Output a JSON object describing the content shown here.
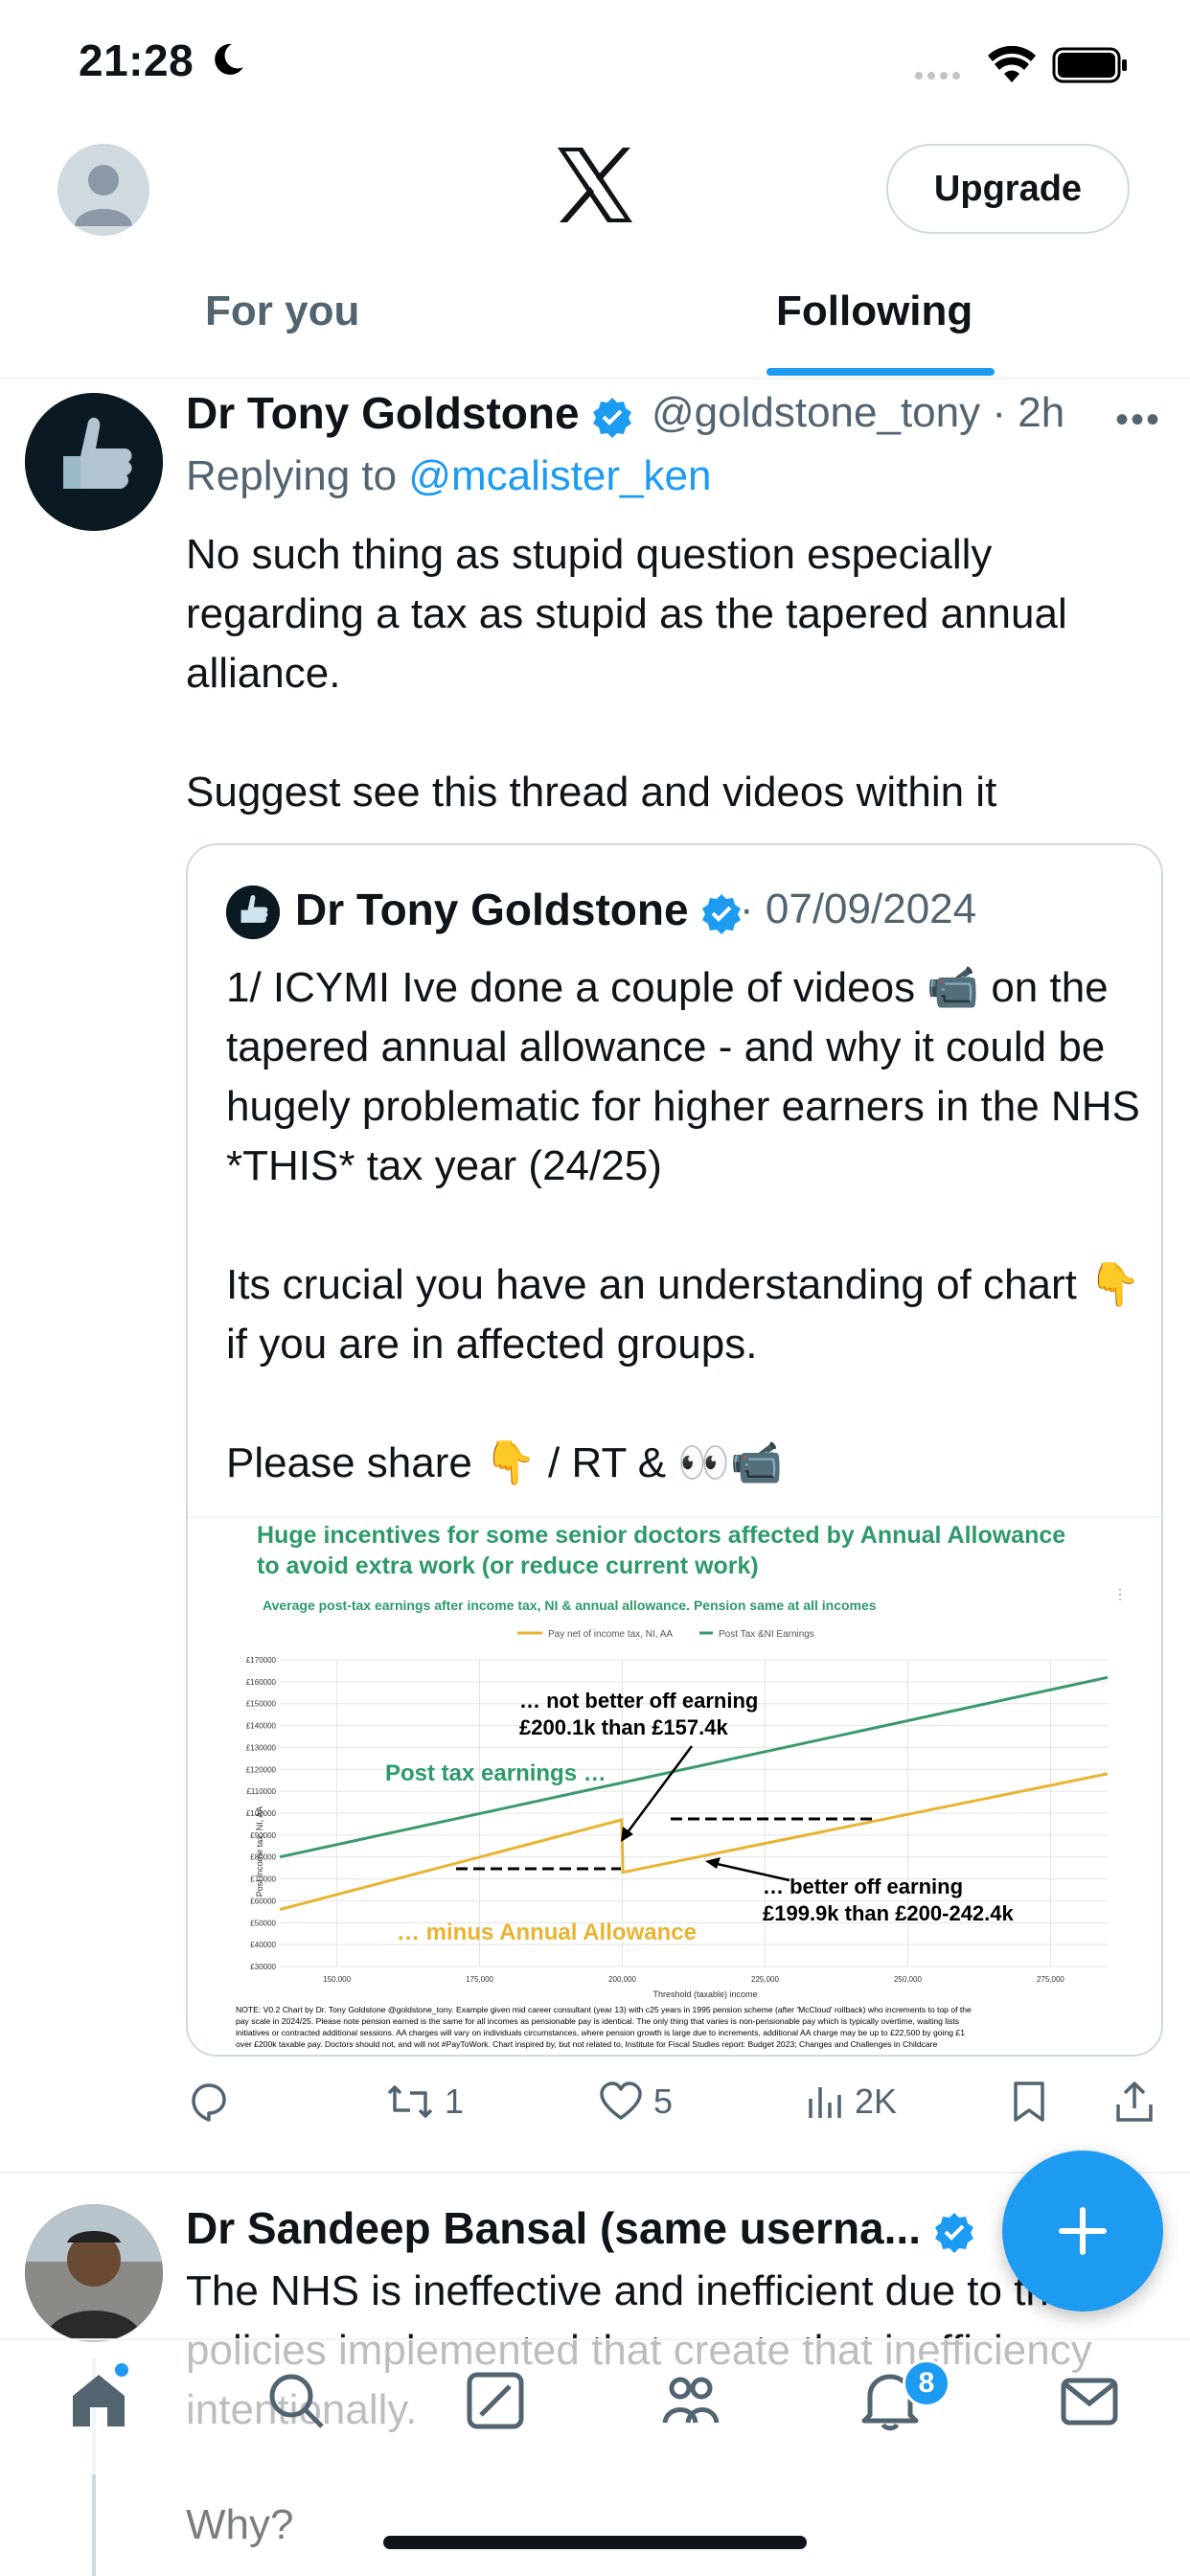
{
  "status_bar": {
    "time": "21:28"
  },
  "header": {
    "upgrade_label": "Upgrade"
  },
  "tabs": [
    {
      "label": "For you"
    },
    {
      "label": "Following"
    }
  ],
  "tweet": {
    "author_name": "Dr Tony Goldstone",
    "handle": "@goldstone_tony",
    "time": "2h",
    "reply_prefix": "Replying to ",
    "reply_handle": "@mcalister_ken",
    "text": "No such thing as stupid question especially regarding a tax as stupid as the tapered annual alliance.\n\nSuggest see this thread and videos within it",
    "quote": {
      "author_name": "Dr Tony Goldstone",
      "date": "07/09/2024",
      "text": "1/ ICYMI Ive done a couple of videos 📹 on the tapered annual allowance - and why it could be hugely problematic for higher earners in the NHS *THIS* tax year (24/25)\n\nIts crucial you have an understanding of chart 👇 if you are in affected groups.\n\nPlease share 👇 / RT & 👀📹",
      "chart": {
        "title_line1": "Huge incentives for some senior doctors affected by Annual Allowance",
        "title_line2": "to avoid extra work (or reduce current work)",
        "subtitle": "Average post-tax earnings after income tax, NI & annual allowance. Pension same at all incomes",
        "legend_1": "Pay net of income tax, NI, AA",
        "legend_2": "Post Tax &NI Earnings",
        "ylabel": "Post income tax, NI, AA",
        "xlabel": "Threshold (taxable) income",
        "annot_top_1": "… not better off earning",
        "annot_top_2": "£200.1k than £157.4k",
        "annot_green": "Post tax earnings …",
        "annot_bottom_1": "… better off earning",
        "annot_bottom_2": "£199.9k than £200-242.4k",
        "annot_orange": "… minus Annual Allowance",
        "note_1": "NOTE: V0.2 Chart by Dr. Tony Goldstone @goldstone_tony. Example given mid career consultant (year 13) with c25 years in 1995 pension scheme (after 'McCloud' rollback) who increments to top of the",
        "note_2": "pay scale in 2024/25. Please note pension earned is the same for all incomes as pensionable pay is identical. The only thing that varies is non-pensionable pay which is typically overtime, waiting lists",
        "note_3": "initiatives or contracted additional sessions. AA charges will vary on individuals circumstances, where pension growth is large due to increments, additional AA charge may be up to £22,500 by going £1",
        "note_4": "over £200k taxable pay. Doctors should not, and will not #PayToWork. Chart inspired by, but not related to, Institute for Fiscal Studies report: Budget 2023; Changes and Challenges in Childcare"
      }
    },
    "stats": {
      "replies": "",
      "reposts": "1",
      "likes": "5",
      "views": "2K"
    }
  },
  "tweet2": {
    "author_name": "Dr Sandeep Bansal (same userna...",
    "text": "The NHS is ineffective and inefficient due to the policies implemented that create that inefficiency intentionally.",
    "text2": "Why?"
  },
  "nav": {
    "notifications_badge": "8"
  },
  "chart_data": {
    "type": "line",
    "title": "Huge incentives for some senior doctors affected by Annual Allowance to avoid extra work (or reduce current work)",
    "subtitle": "Average post-tax earnings after income tax, NI & annual allowance. Pension same at all incomes",
    "xlabel": "Threshold (taxable) income",
    "ylabel": "Post income tax, NI, AA",
    "x_ticks": [
      "150,000",
      "175,000",
      "200,000",
      "225,000",
      "250,000",
      "275,000"
    ],
    "y_ticks": [
      "£30000",
      "£40000",
      "£50000",
      "£60000",
      "£70000",
      "£80000",
      "£90000",
      "£100000",
      "£110000",
      "£120000",
      "£130000",
      "£140000",
      "£150000",
      "£160000",
      "£170000"
    ],
    "xlim": [
      140000,
      285000
    ],
    "ylim": [
      30000,
      170000
    ],
    "legend": "top",
    "series": [
      {
        "name": "Pay net of income tax, NI, AA",
        "color": "#e8b431",
        "points": [
          [
            140000,
            56000
          ],
          [
            199900,
            97000
          ],
          [
            200100,
            73000
          ],
          [
            285000,
            118000
          ]
        ]
      },
      {
        "name": "Post Tax &NI Earnings",
        "color": "#3a9a6e",
        "points": [
          [
            140000,
            80000
          ],
          [
            285000,
            162000
          ]
        ]
      }
    ]
  }
}
